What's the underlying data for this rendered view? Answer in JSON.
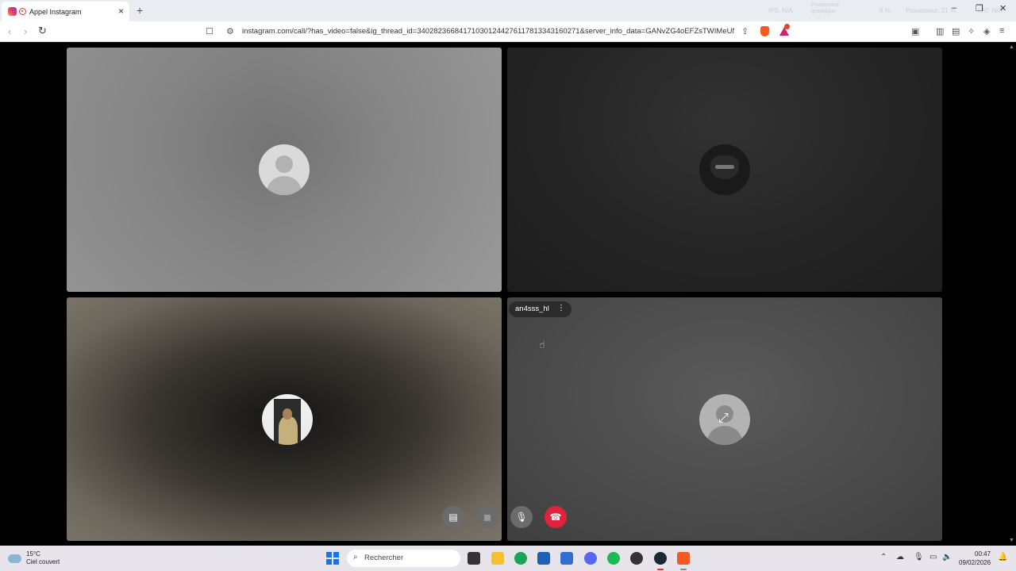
{
  "browser": {
    "tab_title": "Appel Instagram",
    "tab_close": "×",
    "new_tab": "+",
    "url": "instagram.com/call/?has_video=false&ig_thread_id=340282366841710301244276117813343160271&server_info_data=GANvZG4oEFZsTWIMeUN3T...",
    "minimize": "–",
    "restore": "❐",
    "close": "✕",
    "perf_1": "IPS: N/A",
    "perf_2": "Processeur graphique",
    "perf_3": "6 %",
    "perf_4": "Processeur: 21 %",
    "perf_5": "LAT: N/A"
  },
  "call": {
    "participant_label": "an4sss_hl",
    "more_options": "⋮"
  },
  "controls": {
    "share_icon": "▤",
    "camera_icon": "◼",
    "mic_icon": "🎙",
    "end_icon": "☎"
  },
  "taskbar": {
    "temperature": "15°C",
    "weather_desc": "Ciel couvert",
    "search_placeholder": "Rechercher",
    "time": "00:47",
    "date": "09/02/2026"
  },
  "colors": {
    "end_call": "#e0243b",
    "windows_blue": "#1a73e8",
    "brave_orange": "#f25a24"
  }
}
